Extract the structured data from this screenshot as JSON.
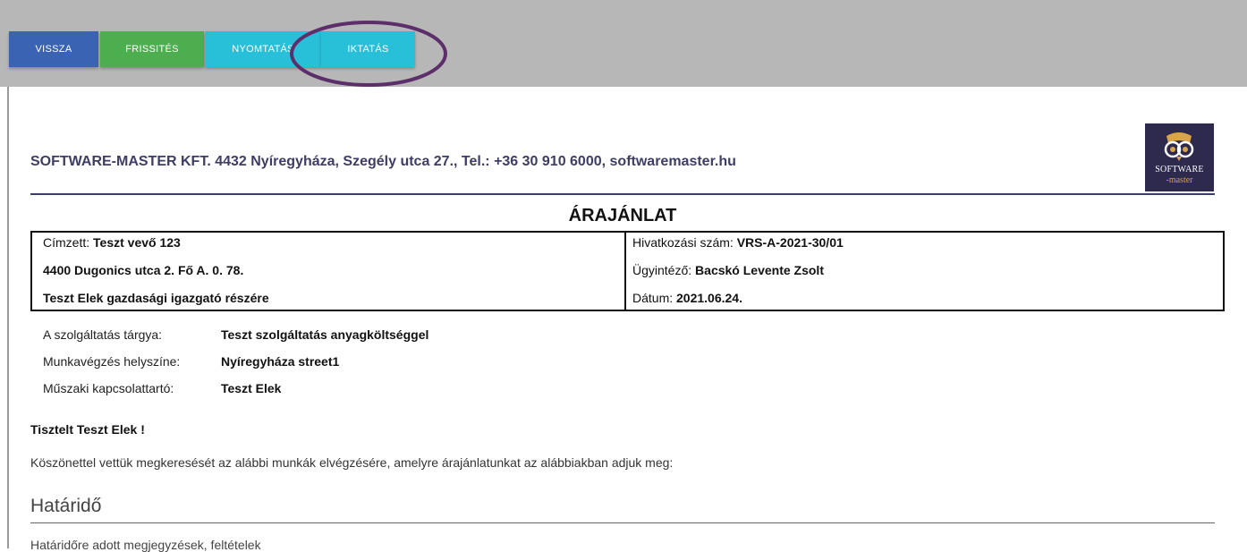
{
  "toolbar": {
    "buttons": [
      {
        "label": "VISSZA",
        "color": "#3a64b3"
      },
      {
        "label": "FRISSITÉS",
        "color": "#4cae4f"
      },
      {
        "label": "NYOMTATÁS",
        "color": "#28bfd9"
      },
      {
        "label": "IKTATÁS",
        "color": "#28bfd9"
      }
    ],
    "highlight_color": "#5c2f6b"
  },
  "header": {
    "company_line": "SOFTWARE-MASTER KFT. 4432 Nyíregyháza, Szegély utca 27., Tel.: +36 30 910 6000, softwaremaster.hu",
    "logo_text_top": "SOFTWARE",
    "logo_text_bottom": "-master",
    "logo_icon": "owl-icon"
  },
  "document": {
    "title": "ÁRAJÁNLAT",
    "recipient": {
      "label": "Címzett:",
      "name": "Teszt vevő 123",
      "address": "4400 Dugonics utca 2. Fő A. 0. 78.",
      "attention": "Teszt Elek gazdasági igazgató részére"
    },
    "reference": {
      "ref_label": "Hivatkozási szám:",
      "ref_value": "VRS-A-2021-30/01",
      "agent_label": "Ügyintéző:",
      "agent_value": "Bacskó Levente Zsolt",
      "date_label": "Dátum:",
      "date_value": "2021.06.24."
    },
    "details": [
      {
        "label": "A szolgáltatás tárgya:",
        "value": "Teszt szolgáltatás anyagköltséggel"
      },
      {
        "label": "Munkavégzés helyszíne:",
        "value": "Nyíregyháza street1"
      },
      {
        "label": "Műszaki kapcsolattartó:",
        "value": "Teszt Elek"
      }
    ],
    "greeting": "Tisztelt Teszt Elek !",
    "intro": "Köszönettel vettük megkeresését az alábbi munkák elvégzésére, amelyre árajánlatunkat az alábbiakban adjuk meg:",
    "section_title": "Határidő",
    "section_note": "Határidőre adott megjegyzések, feltételek"
  }
}
